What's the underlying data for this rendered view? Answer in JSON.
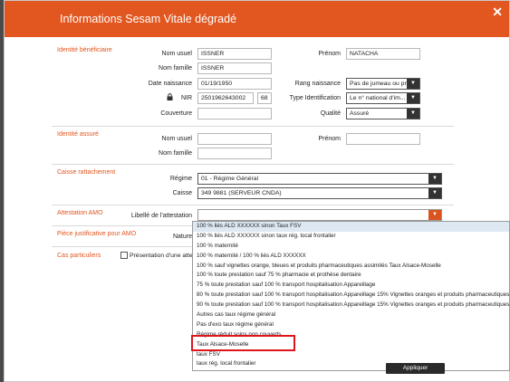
{
  "window": {
    "title": "Informations Sesam Vitale dégradé",
    "close": "✕"
  },
  "beneficiaire": {
    "section": "Identité bénéficiaire",
    "nom_usuel_label": "Nom usuel",
    "nom_usuel": "ISSNER",
    "prenom_label": "Prénom",
    "prenom": "NATACHA",
    "nom_famille_label": "Nom famille",
    "nom_famille": "ISSNER",
    "date_naissance_label": "Date naissance",
    "date_naissance": "01/19/1950",
    "rang_label": "Rang naissance",
    "rang": "Pas de jumeau ou pr...",
    "nir_label": "NIR",
    "nir": "2501962643002",
    "nir_cle": "68",
    "type_id_label": "Type Identification",
    "type_id": "Le n° national d'im...",
    "couverture_label": "Couverture",
    "couverture": "",
    "qualite_label": "Qualité",
    "qualite": "Assuré"
  },
  "assure": {
    "section": "Identité assuré",
    "nom_usuel_label": "Nom usuel",
    "nom_usuel": "",
    "prenom_label": "Prénom",
    "prenom": "",
    "nom_famille_label": "Nom famille",
    "nom_famille": ""
  },
  "caisse": {
    "section": "Caisse rattachement",
    "regime_label": "Régime",
    "regime": "01 - Régime Général",
    "caisse_label": "Caisse",
    "caisse": "349 9881 (SERVEUR CNDA)"
  },
  "amo": {
    "section": "Attestation AMO",
    "libelle_label": "Libellé de l'attestation",
    "libelle": ""
  },
  "piece": {
    "section": "Pièce justificative pour AMO",
    "nature_label": "Nature"
  },
  "cas": {
    "section": "Cas particuliers",
    "presentation_label": "Présentation d'une attesta"
  },
  "dropdown": {
    "options": [
      "100 % liés ALD XXXXXX sinon Taux FSV",
      "100 % liés ALD XXXXXX sinon taux rég. local frontalier",
      "100 % maternité",
      "100 % maternité / 100 % liés ALD XXXXXX",
      "100 % sauf vignettes orange, bleues et produits pharmaceutiques assimilés Taux Alsace-Moselle",
      "100 % toute prestation sauf 75 % pharmacie et prothèse dentaire",
      "75 % toute prestation sauf 100 % transport hospitalisation Appareillage",
      "80 % toute prestation sauf 100 % transport hospitalisation Appareillage 15% Vignettes oranges et produits pharmaceutiques",
      "90 % toute prestation sauf 100 % transport hospitalisation Appareillage 15% Vignettes oranges et produits pharmaceutiques",
      "Autres cas taux régime général",
      "Pas d'exo taux régime général",
      "Régime réduit soins non couverts",
      "Taux Alsace-Moselle",
      "taux FSV",
      "taux rég. local frontalier"
    ]
  },
  "footer": {
    "button": "Appliquer"
  }
}
